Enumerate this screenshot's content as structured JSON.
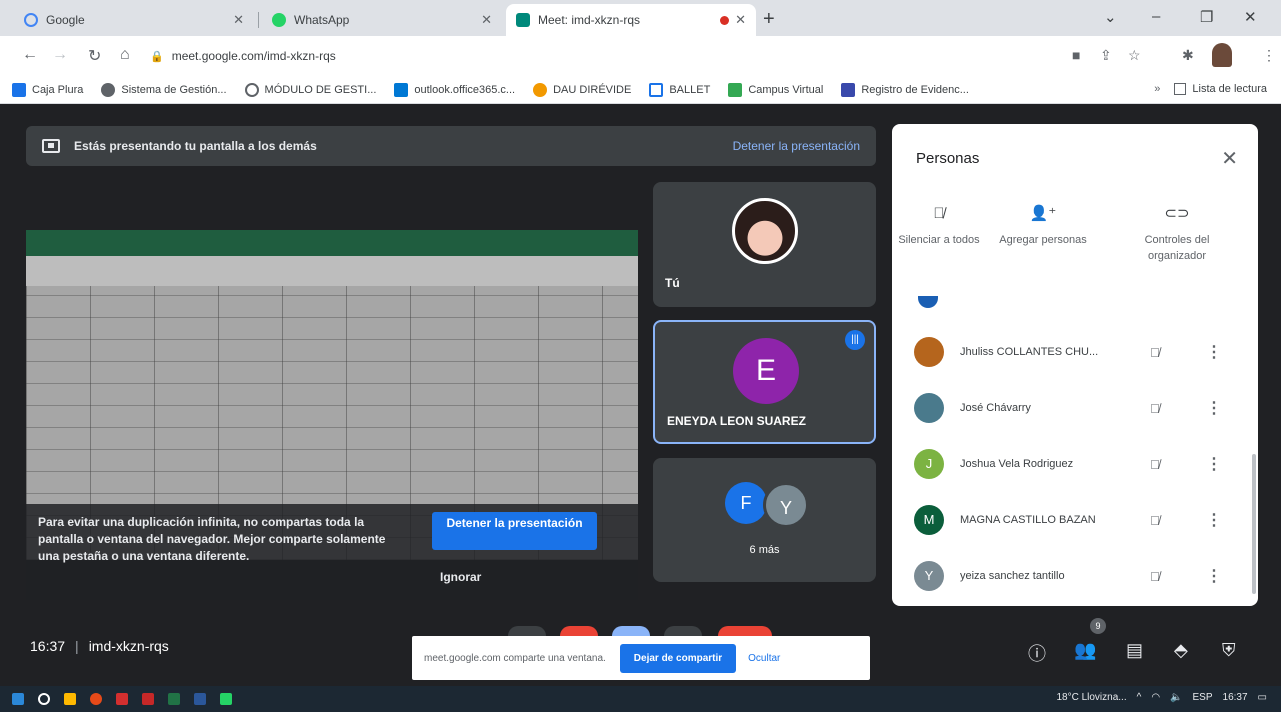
{
  "browser": {
    "tabs": [
      {
        "title": "Google",
        "favicon_color": "#4285f4"
      },
      {
        "title": "WhatsApp",
        "favicon_color": "#25d366"
      },
      {
        "title": "Meet: imd-xkzn-rqs",
        "favicon_color": "#00897b",
        "recording": true
      }
    ],
    "url": "meet.google.com/imd-xkzn-rqs",
    "bookmarks": [
      {
        "label": "Caja Plura",
        "color": "#1a73e8"
      },
      {
        "label": "Sistema de Gestión...",
        "color": "#5f6368"
      },
      {
        "label": "MÓDULO DE GESTI...",
        "color": "#5f6368"
      },
      {
        "label": "outlook.office365.c...",
        "color": "#0078d4"
      },
      {
        "label": "DAU DIRÉVIDE",
        "color": "#f29900"
      },
      {
        "label": "BALLET",
        "color": "#1a73e8"
      },
      {
        "label": "Campus Virtual",
        "color": "#34a853"
      },
      {
        "label": "Registro de Evidenc...",
        "color": "#3949ab"
      }
    ],
    "reading_list": "Lista de lectura"
  },
  "meet": {
    "presenting_banner": "Estás presentando tu pantalla a los demás",
    "stop_presenting_link": "Detener la presentación",
    "warning": {
      "text": "Para evitar una duplicación infinita, no compartas toda la pantalla o ventana del navegador. Mejor comparte solamente una pestaña o una ventana diferente.",
      "stop_button": "Detener la presentación",
      "ignore_button": "Ignorar"
    },
    "tiles": {
      "self_label": "Tú",
      "speaker_initial": "E",
      "speaker_name": "ENEYDA LEON SUAREZ",
      "more_initials": [
        "F",
        "Y"
      ],
      "more_label": "6 más"
    },
    "meeting_time": "16:37",
    "meeting_code": "imd-xkzn-rqs",
    "share_infobar": {
      "text": "meet.google.com comparte una ventana.",
      "stop_button": "Dejar de compartir",
      "hide_button": "Ocultar"
    },
    "people_badge": "9"
  },
  "people_panel": {
    "title": "Personas",
    "actions": [
      {
        "label": "Silenciar a todos",
        "icon": "mic-off-icon"
      },
      {
        "label": "Agregar personas",
        "icon": "add-person-icon"
      },
      {
        "label": "Controles del organizador",
        "icon": "host-controls-icon"
      }
    ],
    "participants": [
      {
        "name": "Jhuliss COLLANTES CHU...",
        "initial": "",
        "color": "#b5651d"
      },
      {
        "name": "José Chávarry",
        "initial": "",
        "color": "#4a7a8c"
      },
      {
        "name": "Joshua Vela Rodriguez",
        "initial": "J",
        "color": "#7cb342"
      },
      {
        "name": "MAGNA CASTILLO BAZAN",
        "initial": "M",
        "color": "#0b5e3b"
      },
      {
        "name": "yeiza sanchez tantillo",
        "initial": "Y",
        "color": "#7a8a93"
      }
    ]
  },
  "taskbar": {
    "weather": "18°C Llovizna...",
    "language": "ESP",
    "time": "16:37"
  }
}
